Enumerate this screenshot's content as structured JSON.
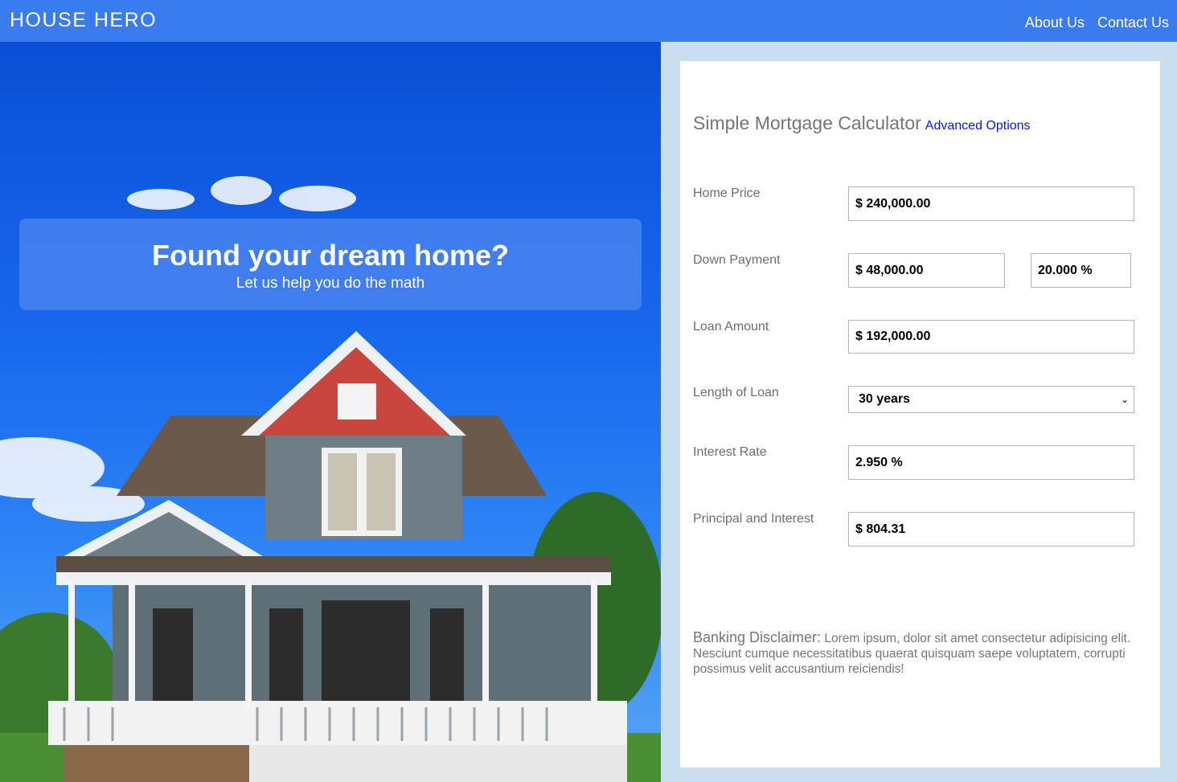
{
  "header": {
    "brand": "HOUSE HERO",
    "nav": [
      "About Us",
      "Contact Us"
    ]
  },
  "hero": {
    "title": "Found your dream home?",
    "subtitle": "Let us help you do the math"
  },
  "calculator": {
    "title": "Simple Mortgage Calculator",
    "advanced_link": "Advanced Options",
    "home_price": {
      "label": "Home Price",
      "value": "$ 240,000.00"
    },
    "down_payment": {
      "label": "Down Payment",
      "value": "$ 48,000.00",
      "percent": "20.000 %"
    },
    "loan_amount": {
      "label": "Loan Amount",
      "value": "$ 192,000.00"
    },
    "length_of_loan": {
      "label": "Length of Loan",
      "value": "30 years"
    },
    "interest_rate": {
      "label": "Interest Rate",
      "value": "2.950 %"
    },
    "principal_interest": {
      "label": "Principal and Interest",
      "value": "$ 804.31"
    },
    "disclaimer": {
      "lead": "Banking Disclaimer:",
      "body": "Lorem ipsum, dolor sit amet consectetur adipisicing elit. Nesciunt cumque necessitatibus quaerat quisquam saepe voluptatem, corrupti possimus velit accusantium reiciendis!"
    }
  },
  "colors": {
    "header_bg": "#3a7bef",
    "page_bg": "#c9dff0",
    "link": "#0a16e0"
  }
}
